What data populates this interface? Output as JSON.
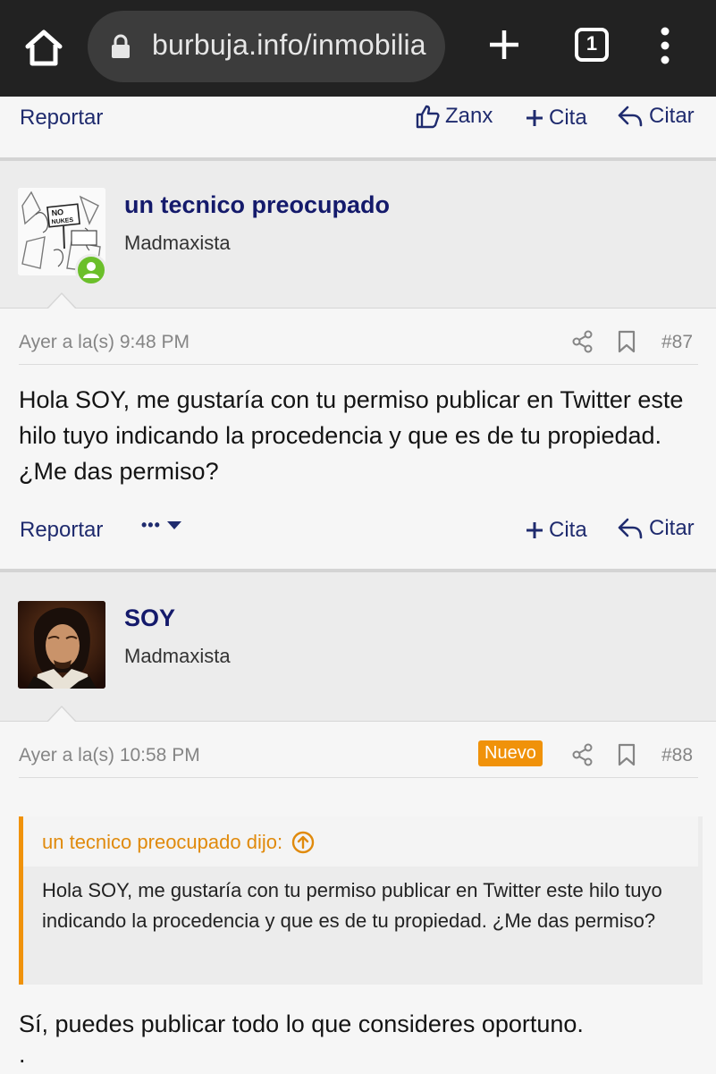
{
  "browser": {
    "url": "burbuja.info/inmobilia",
    "tab_count": "1",
    "icons": [
      "home-icon",
      "lock-icon",
      "new-tab-icon",
      "tab-switcher-icon",
      "overflow-menu-icon"
    ]
  },
  "post_prev": {
    "report_label": "Reportar",
    "like_label": "Zanx",
    "quote_label": "Cita",
    "reply_label": "Citar"
  },
  "post87": {
    "username": "un tecnico preocupado",
    "user_title": "Madmaxista",
    "date": "Ayer a la(s) 9:48 PM",
    "post_number": "#87",
    "body": "Hola SOY, me gustaría con tu permiso publicar en Twitter este hilo tuyo indicando la procedencia y que es de tu propiedad. ¿Me das permiso?",
    "report_label": "Reportar",
    "more_label": "•••",
    "quote_label": "Cita",
    "reply_label": "Citar",
    "avatar_text_1": "NO",
    "avatar_text_2": "NUKES",
    "online_status": "online"
  },
  "post88": {
    "username": "SOY",
    "user_title": "Madmaxista",
    "date": "Ayer a la(s) 10:58 PM",
    "badge": "Nuevo",
    "post_number": "#88",
    "quote_author": "un tecnico preocupado dijo:",
    "quote_text": "Hola SOY, me gustaría con tu permiso publicar en Twitter este hilo tuyo indicando la procedencia y que es de tu propiedad. ¿Me das permiso?",
    "body": "Sí, puedes publicar todo lo que consideres oportuno.",
    "body_tail": "."
  },
  "colors": {
    "link": "#1f2b6e",
    "username": "#141a6b",
    "accent": "#f0920a",
    "online": "#6bbf2a"
  }
}
